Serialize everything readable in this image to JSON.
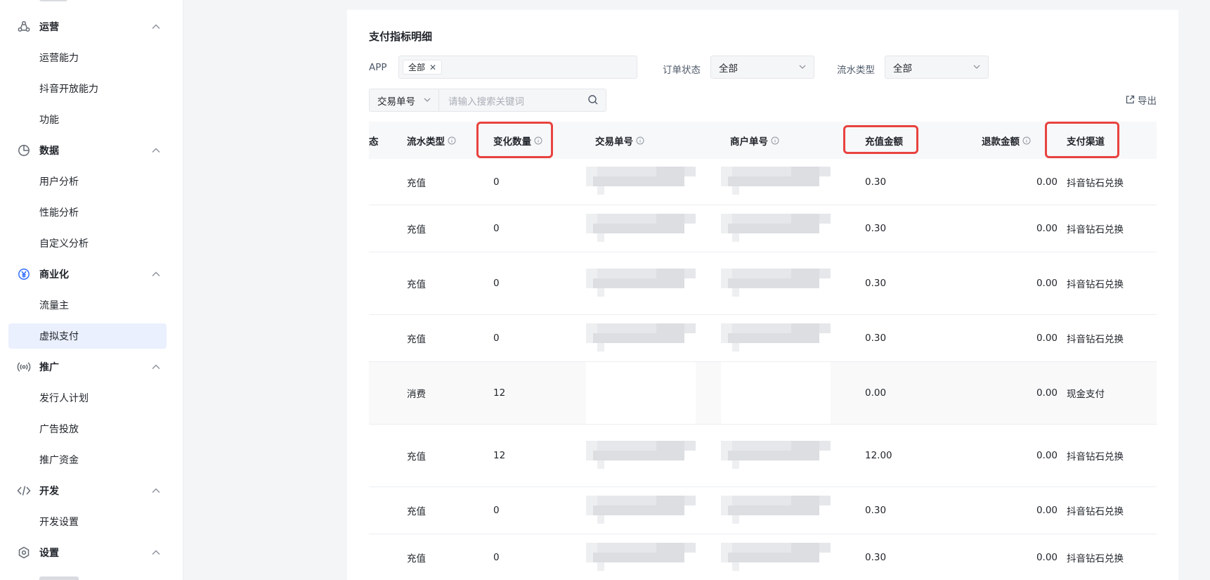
{
  "sidebar": {
    "groups": [
      {
        "label": "运营",
        "icon": "operations-icon",
        "items": [
          "运营能力",
          "抖音开放能力",
          "功能"
        ]
      },
      {
        "label": "数据",
        "icon": "pie-chart-icon",
        "items": [
          "用户分析",
          "性能分析",
          "自定义分析"
        ]
      },
      {
        "label": "商业化",
        "icon": "yuan-circle-icon",
        "items": [
          "流量主",
          "虚拟支付"
        ]
      },
      {
        "label": "推广",
        "icon": "broadcast-icon",
        "items": [
          "发行人计划",
          "广告投放",
          "推广资金"
        ]
      },
      {
        "label": "开发",
        "icon": "code-icon",
        "items": [
          "开发设置"
        ]
      },
      {
        "label": "设置",
        "icon": "hexagon-gear-icon",
        "items": []
      }
    ],
    "active_item": "虚拟支付"
  },
  "main": {
    "title": "支付指标明细",
    "filters": {
      "app_label": "APP",
      "app_tag": "全部",
      "order_status_label": "订单状态",
      "order_status_value": "全部",
      "flow_type_label": "流水类型",
      "flow_type_value": "全部"
    },
    "search": {
      "field": "交易单号",
      "placeholder": "请输入搜索关键词"
    },
    "export_label": "导出",
    "table": {
      "cut_header": "态",
      "columns": [
        "流水类型",
        "变化数量",
        "交易单号",
        "商户单号",
        "充值金额",
        "退款金额",
        "支付渠道"
      ],
      "rows": [
        {
          "flow_type": "充值",
          "qty": "0",
          "recharge": "0.30",
          "refund": "0.00",
          "channel": "抖音钻石兑换"
        },
        {
          "flow_type": "充值",
          "qty": "0",
          "recharge": "0.30",
          "refund": "0.00",
          "channel": "抖音钻石兑换"
        },
        {
          "flow_type": "充值",
          "qty": "0",
          "recharge": "0.30",
          "refund": "0.00",
          "channel": "抖音钻石兑换"
        },
        {
          "flow_type": "充值",
          "qty": "0",
          "recharge": "0.30",
          "refund": "0.00",
          "channel": "抖音钻石兑换"
        },
        {
          "flow_type": "消费",
          "qty": "12",
          "recharge": "0.00",
          "refund": "0.00",
          "channel": "现金支付"
        },
        {
          "flow_type": "充值",
          "qty": "12",
          "recharge": "12.00",
          "refund": "0.00",
          "channel": "抖音钻石兑换"
        },
        {
          "flow_type": "充值",
          "qty": "0",
          "recharge": "0.30",
          "refund": "0.00",
          "channel": "抖音钻石兑换"
        },
        {
          "flow_type": "充值",
          "qty": "0",
          "recharge": "0.30",
          "refund": "0.00",
          "channel": "抖音钻石兑换"
        }
      ]
    },
    "highlight_color": "#e8433f",
    "accent_color": "#3370ff"
  }
}
